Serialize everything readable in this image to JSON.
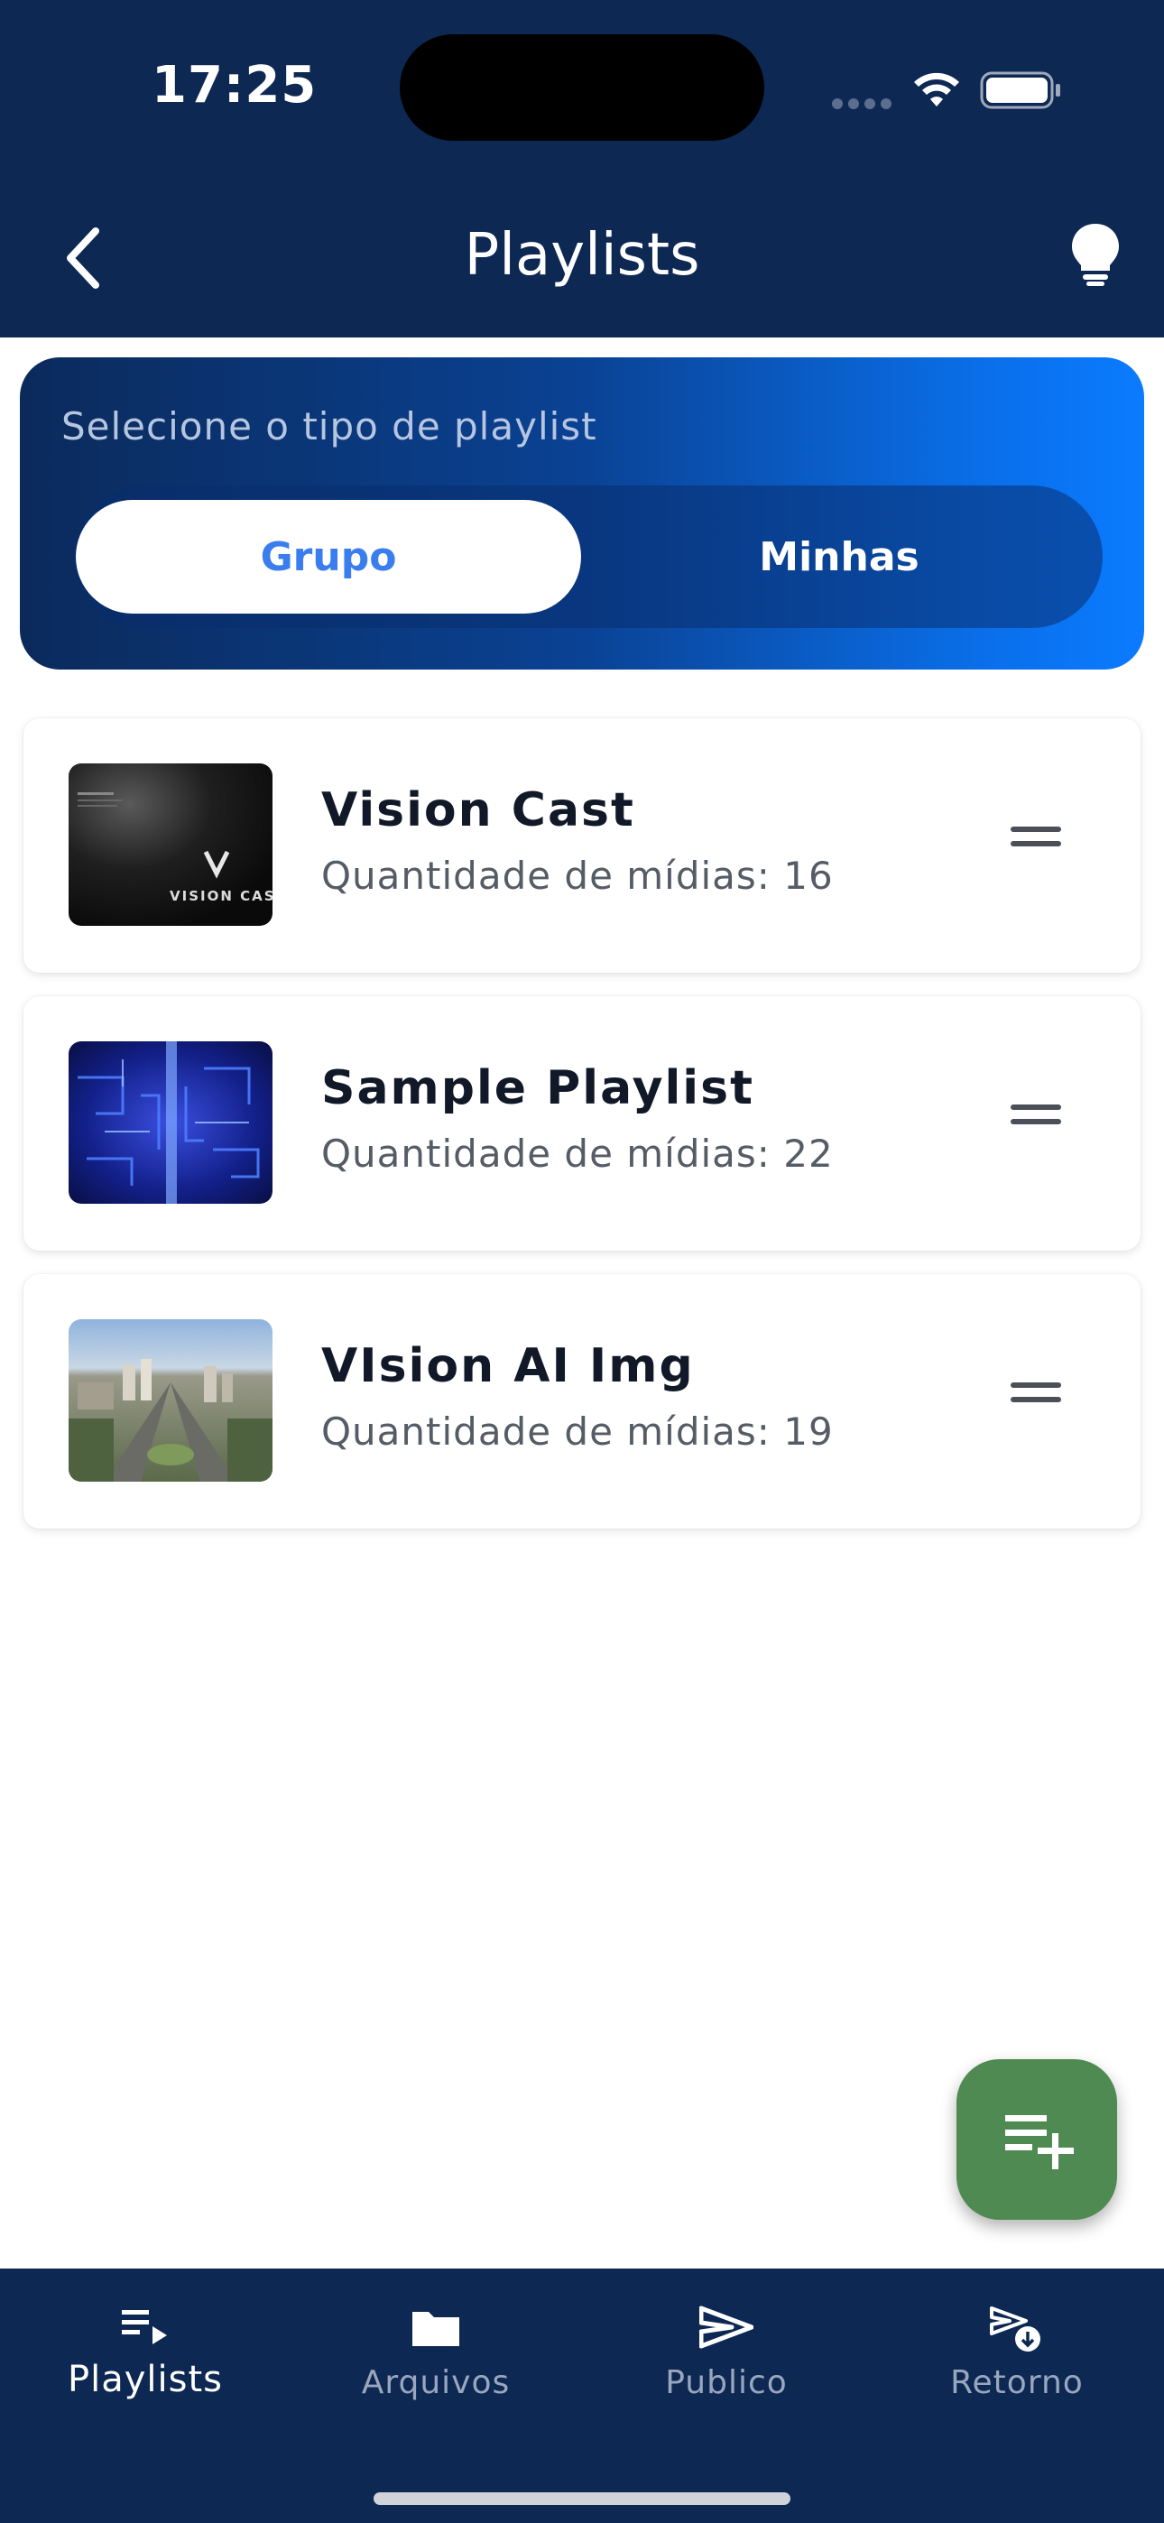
{
  "status_bar": {
    "time": "17:25"
  },
  "header": {
    "title": "Playlists",
    "back_icon": "chevron-left-icon",
    "tip_icon": "lightbulb-icon"
  },
  "type_selector": {
    "label": "Selecione o tipo de playlist",
    "options": [
      "Grupo",
      "Minhas"
    ],
    "selected": "Grupo"
  },
  "playlists": [
    {
      "name": "Vision Cast",
      "subtitle": "Quantidade de mídias: 16",
      "thumb_text": "VISION CAST"
    },
    {
      "name": "Sample Playlist",
      "subtitle": "Quantidade de mídias: 22"
    },
    {
      "name": "VIsion AI Img",
      "subtitle": "Quantidade de mídias: 19"
    }
  ],
  "fab": {
    "icon": "playlist-add-icon",
    "color": "#4f8a52"
  },
  "tabbar": {
    "items": [
      {
        "label": "Playlists",
        "icon": "playlist-play-icon",
        "active": true
      },
      {
        "label": "Arquivos",
        "icon": "folder-icon",
        "active": false
      },
      {
        "label": "Publico",
        "icon": "send-icon",
        "active": false
      },
      {
        "label": "Retorno",
        "icon": "send-download-icon",
        "active": false
      }
    ]
  },
  "colors": {
    "header_bg": "#0d2852",
    "accent": "#3a7dee",
    "gradient_end": "#0b7bff"
  }
}
